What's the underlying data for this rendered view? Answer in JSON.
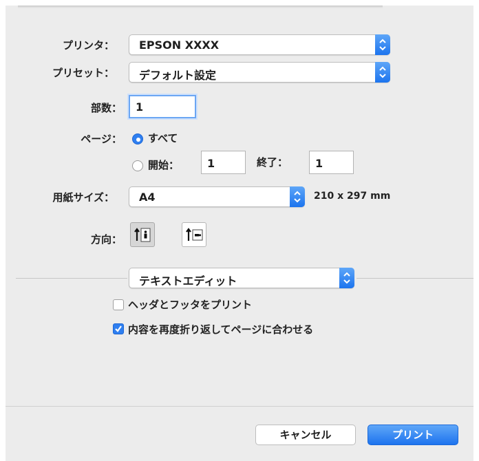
{
  "printer": {
    "label": "プリンタ：",
    "value": "EPSON XXXX"
  },
  "preset": {
    "label": "プリセット：",
    "value": "デフォルト設定"
  },
  "copies": {
    "label": "部数：",
    "value": "1"
  },
  "pages": {
    "label": "ページ：",
    "all_label": "すべて",
    "from_label": "開始：",
    "from_value": "1",
    "to_label": "終了：",
    "to_value": "1",
    "selected": "all"
  },
  "paper_size": {
    "label": "用紙サイズ：",
    "value": "A4",
    "dimensions": "210 x 297 mm"
  },
  "orientation": {
    "label": "方向：",
    "selected": "portrait"
  },
  "app_section": {
    "value": "テキストエディット"
  },
  "options": {
    "header_footer": {
      "label": "ヘッダとフッタをプリント",
      "checked": false
    },
    "rewrap": {
      "label": "内容を再度折り返してページに合わせる",
      "checked": true
    }
  },
  "buttons": {
    "cancel": "キャンセル",
    "print": "プリント"
  },
  "colors": {
    "accent": "#2f7ff0",
    "panel": "#ececec"
  }
}
